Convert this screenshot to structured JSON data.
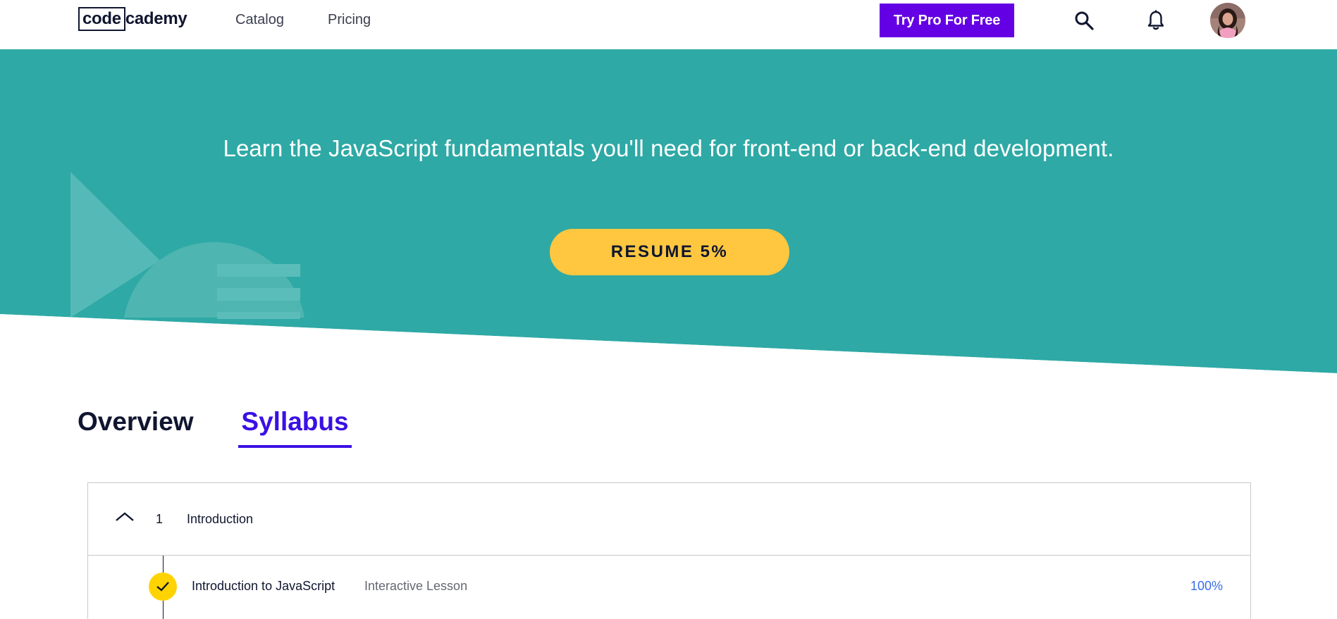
{
  "header": {
    "logo_box": "code",
    "logo_rest": "cademy",
    "nav": [
      "Catalog",
      "Pricing"
    ],
    "try_pro": "Try Pro For Free",
    "icons": [
      "search-icon",
      "bell-icon"
    ],
    "avatar": "user-avatar"
  },
  "hero": {
    "title": "Learn the JavaScript fundamentals you'll need for front-end or back-end development.",
    "resume": "RESUME 5%",
    "background": "#2ea9a5"
  },
  "tabs": [
    {
      "label": "Overview",
      "active": false
    },
    {
      "label": "Syllabus",
      "active": true
    }
  ],
  "syllabus": {
    "module": {
      "number": "1",
      "title": "Introduction",
      "expanded": true
    },
    "lessons": [
      {
        "title": "Introduction to JavaScript",
        "type": "Interactive Lesson",
        "progress": "100%",
        "completed": true
      }
    ]
  },
  "colors": {
    "accent": "#3a10e5",
    "pro": "#6400e4",
    "resume": "#ffc740",
    "check": "#ffd300",
    "progress_text": "#3a6ee5"
  }
}
